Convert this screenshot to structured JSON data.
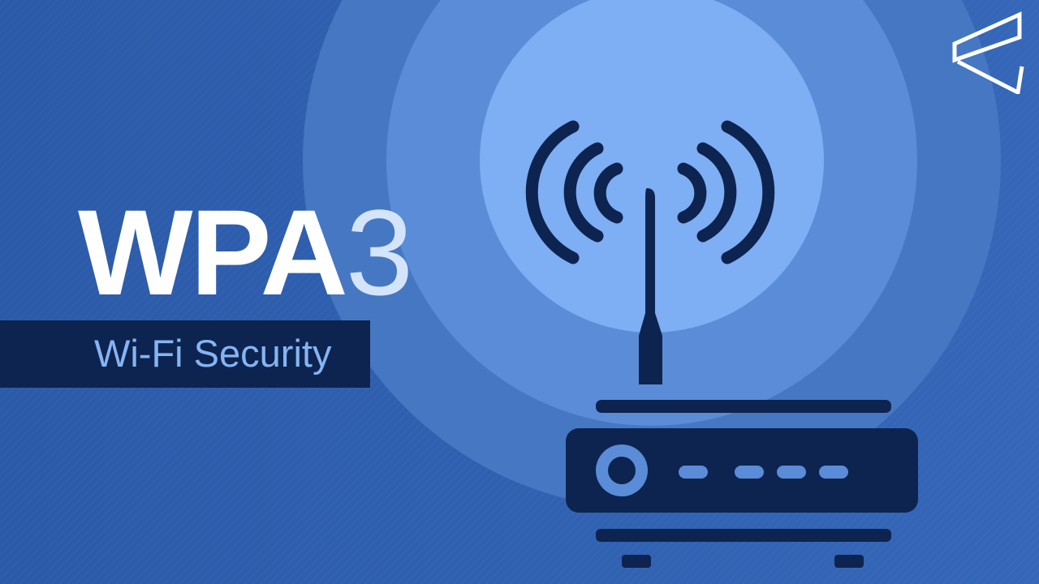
{
  "title": {
    "main": "WPA",
    "suffix": "3"
  },
  "subtitle": "Wi-Fi Security",
  "icons": {
    "router": "wifi-router-icon",
    "signal": "wifi-signal-icon",
    "brand_logo": "brand-logo-icon"
  },
  "colors": {
    "background": "#2f60b0",
    "ring_outer": "#4677c2",
    "ring_mid": "#5a8cd8",
    "ring_inner": "#7eaef3",
    "navy": "#0d2450",
    "title_main": "#ffffff",
    "title_suffix": "#d3e4fb",
    "subtitle_text": "#86b4f3",
    "logo": "#ffffff"
  }
}
